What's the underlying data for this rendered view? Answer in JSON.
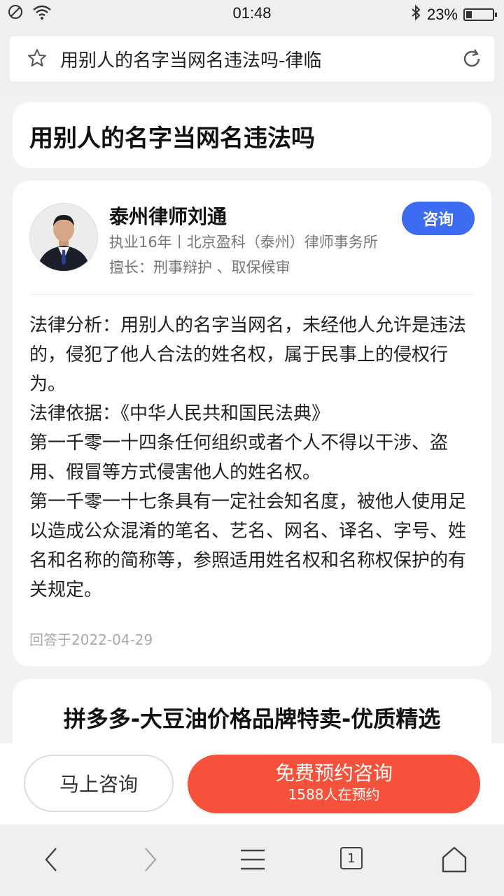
{
  "status_bar": {
    "time": "01:48",
    "battery_percent": "23%",
    "battery_level": 0.23,
    "icons": [
      "dnd-icon",
      "wifi-icon",
      "bluetooth-icon",
      "battery-icon"
    ]
  },
  "address_bar": {
    "title": "用别人的名字当网名违法吗-律临",
    "icons": [
      "star-icon",
      "reload-icon"
    ]
  },
  "question": {
    "title": "用别人的名字当网名违法吗"
  },
  "lawyer": {
    "name": "泰州律师刘通",
    "meta": "执业16年丨北京盈科（泰州）律师事务所",
    "skill": "擅长：刑事辩护 、取保候审",
    "consult_label": "咨询"
  },
  "answer": {
    "paragraphs": [
      "法律分析：用别人的名字当网名，未经他人允许是违法的，侵犯了他人合法的姓名权，属于民事上的侵权行为。",
      "法律依据：《中华人民共和国民法典》",
      "第一千零一十四条任何组织或者个人不得以干涉、盗用、假冒等方式侵害他人的姓名权。",
      "第一千零一十七条具有一定社会知名度，被他人使用足以造成公众混淆的笔名、艺名、网名、译名、字号、姓名和名称的简称等，参照适用姓名权和名称权保护的有关规定。"
    ],
    "date": "回答于2022-04-29"
  },
  "ad": {
    "title": "拼多多-大豆油价格品牌特卖-优质精选"
  },
  "actions": {
    "now_label": "马上咨询",
    "free_label": "免费预约咨询",
    "free_sub": "1588人在预约"
  },
  "browser_nav": {
    "tab_count": "1",
    "icons": [
      "back-icon",
      "forward-icon",
      "menu-icon",
      "tabs-icon",
      "home-icon"
    ]
  },
  "colors": {
    "consult_button": "#3b6cf2",
    "free_button": "#f5513b",
    "background": "#f2f2f2"
  }
}
